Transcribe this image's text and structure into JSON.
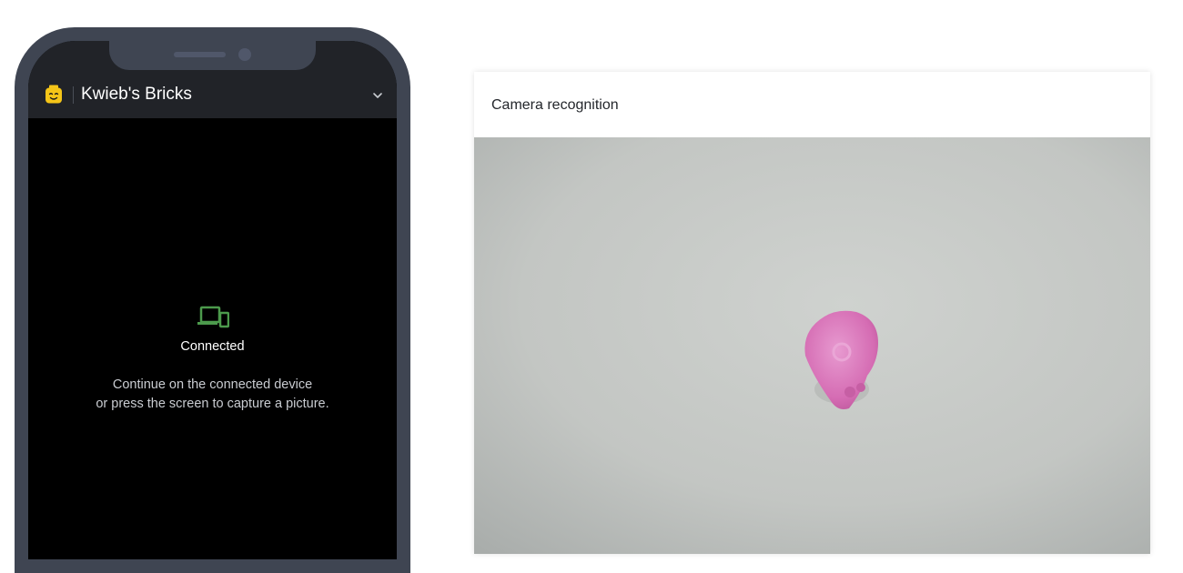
{
  "app": {
    "name": "Kwieb's Bricks",
    "logo_icon": "lego-head-icon",
    "menu_icon": "chevron-down-icon"
  },
  "phone": {
    "status_icon": "devices-icon",
    "status_title": "Connected",
    "message_line_1": "Continue on the connected device",
    "message_line_2": "or press the screen to capture a picture."
  },
  "camera_card": {
    "title": "Camera recognition",
    "feed_subject": "pink brick piece"
  },
  "colors": {
    "phone_frame": "#3f4552",
    "app_header": "#212328",
    "screen_background": "#000000",
    "connected_green": "#4c9a4c",
    "logo_yellow": "#f5c518",
    "brick_pink": "#d96fb5",
    "feed_background": "#c3c6c3"
  }
}
